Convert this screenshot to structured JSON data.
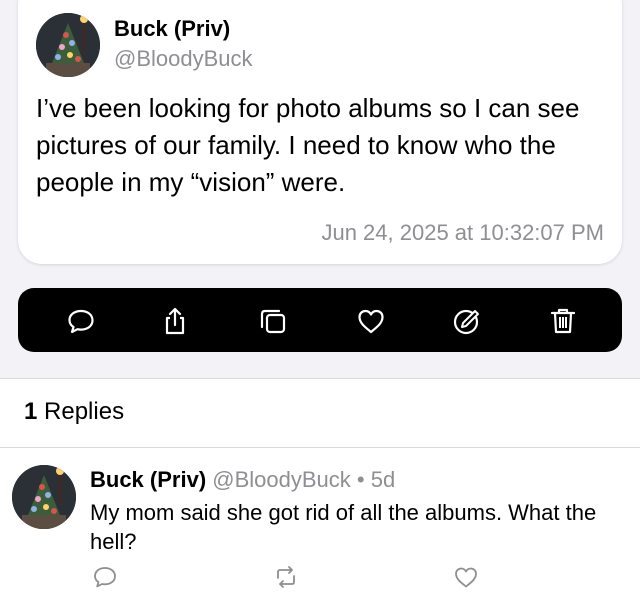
{
  "post": {
    "name": "Buck (Priv)",
    "handle": "@BloodyBuck",
    "text": "I’ve been looking for photo albums so I can see pictures of our family. I need to know who the people in my “vision” were.",
    "timestamp": "Jun 24, 2025 at 10:32:07 PM",
    "avatar_icon": "christmas-tree-avatar"
  },
  "action_bar": {
    "icons": [
      "comment-icon",
      "share-icon",
      "copy-icon",
      "heart-icon",
      "edit-icon",
      "trash-icon"
    ]
  },
  "replies": {
    "count": "1",
    "label": " Replies",
    "items": [
      {
        "name": "Buck (Priv)",
        "handle": "@BloodyBuck",
        "separator": "•",
        "age": "5d",
        "text": "My mom said she got rid of all the albums. What the hell?",
        "actions": [
          "comment-icon",
          "repost-icon",
          "heart-icon"
        ]
      }
    ]
  },
  "colors": {
    "background": "#f2f2f7",
    "card": "#ffffff",
    "secondary_text": "#8e8e93",
    "action_bar": "#000000"
  }
}
